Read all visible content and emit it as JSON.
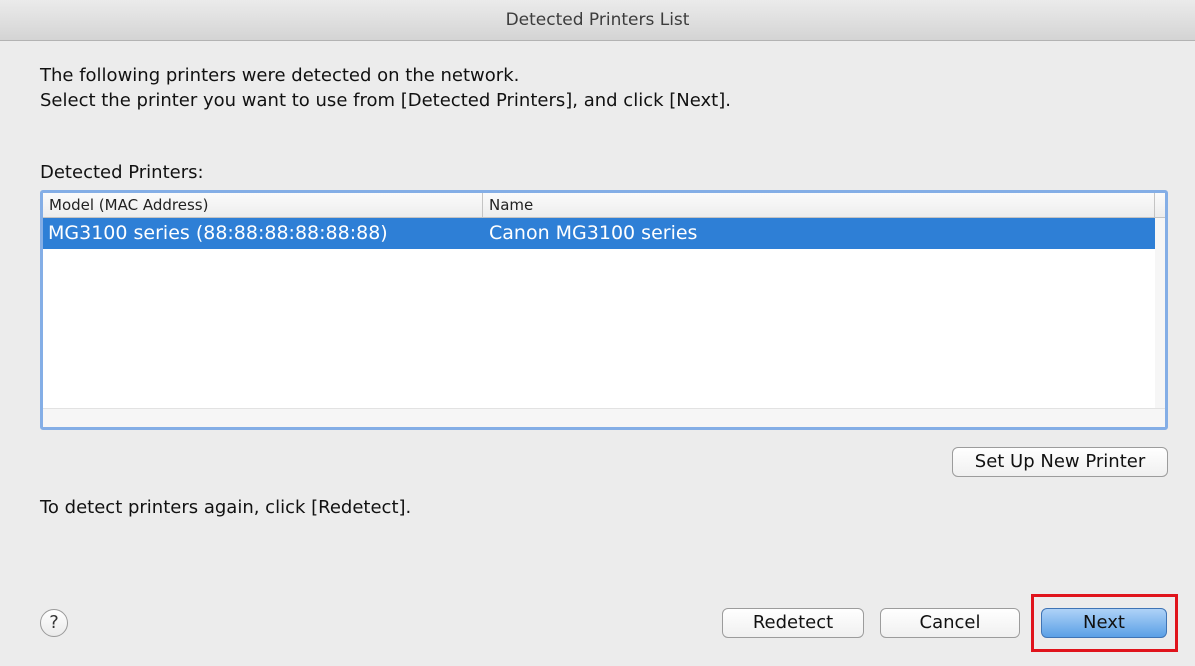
{
  "window": {
    "title": "Detected Printers List"
  },
  "intro": {
    "line1": "The following printers were detected on the network.",
    "line2": "Select the printer you want to use from [Detected Printers], and click [Next]."
  },
  "list": {
    "label": "Detected Printers:",
    "columns": [
      "Model (MAC Address)",
      "Name"
    ],
    "rows": [
      {
        "model": "MG3100 series (88:88:88:88:88:88)",
        "name": "Canon MG3100 series",
        "selected": true
      }
    ]
  },
  "buttons": {
    "setup": "Set Up New Printer",
    "redetect": "Redetect",
    "cancel": "Cancel",
    "next": "Next",
    "help": "?"
  },
  "redetect_hint": "To detect printers again, click [Redetect].",
  "colors": {
    "selection": "#2e7fd6",
    "focus_ring": "#84aee6",
    "highlight_box": "#e0141c",
    "default_button": "#5aa0e6"
  }
}
